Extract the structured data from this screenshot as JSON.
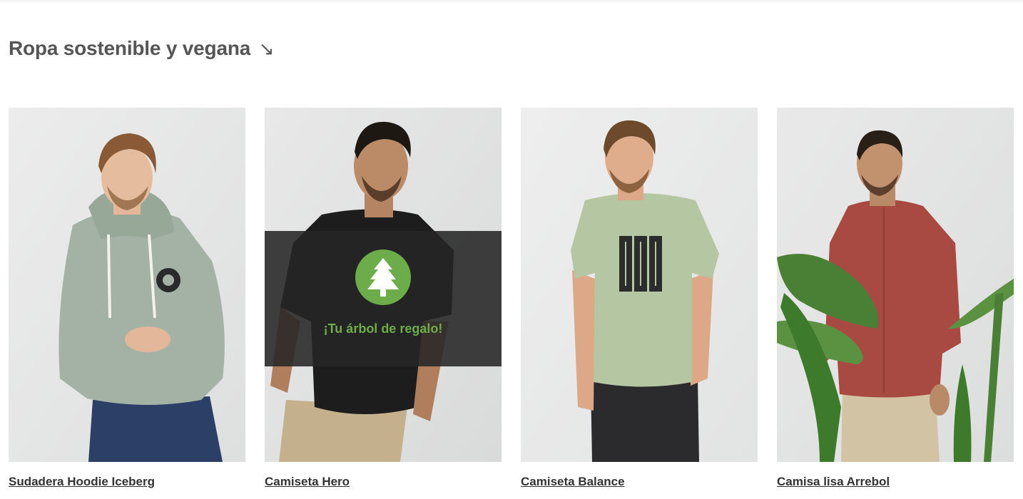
{
  "section": {
    "title": "Ropa sostenible y vegana",
    "arrow_icon": "arrow-down-right-icon",
    "arrow_glyph": "↘"
  },
  "products": [
    {
      "name": "Sudadera Hoodie Iceberg",
      "image": "man-in-sage-green-hoodie-photo",
      "garment_color": "#a3b2a4"
    },
    {
      "name": "Camiseta Hero",
      "image": "man-in-black-tshirt-photo",
      "garment_color": "#1d1d1d"
    },
    {
      "name": "Camiseta Balance",
      "image": "man-in-light-green-tshirt-photo",
      "garment_color": "#b5c6a3"
    },
    {
      "name": "Camisa lisa Arrebol",
      "image": "man-in-red-shirt-photo",
      "garment_color": "#a94a42"
    }
  ],
  "promo_overlay": {
    "text": "¡Tu árbol de regalo!",
    "icon": "tree-icon",
    "accent_color": "#6cac4a"
  },
  "colors": {
    "heading": "#555555",
    "link": "#333333",
    "photo_background": "#e6e7e7"
  }
}
